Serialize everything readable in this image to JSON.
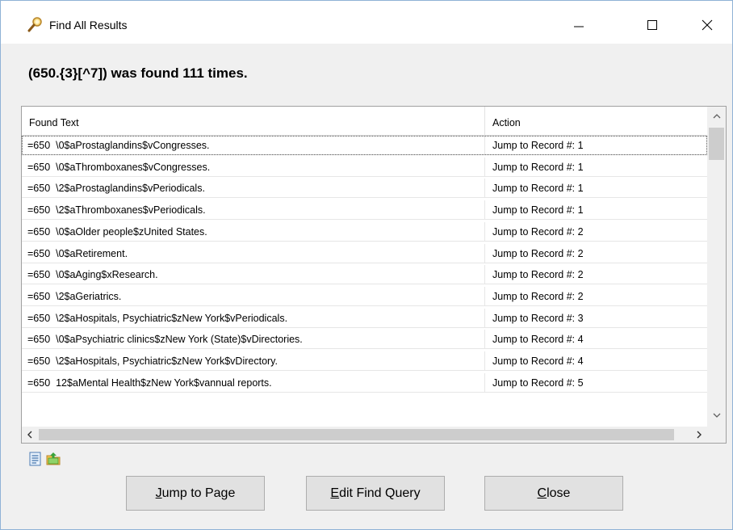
{
  "window": {
    "title": "Find All Results",
    "title_icon": "magnifier-icon"
  },
  "header": {
    "message": "(650.{3}[^7]) was found 111 times."
  },
  "grid": {
    "columns": [
      "Found Text",
      "Action"
    ],
    "rows": [
      {
        "found": "=650  \\0$aProstaglandins$vCongresses.",
        "action": "Jump to Record #: 1"
      },
      {
        "found": "=650  \\0$aThromboxanes$vCongresses.",
        "action": "Jump to Record #: 1"
      },
      {
        "found": "=650  \\2$aProstaglandins$vPeriodicals.",
        "action": "Jump to Record #: 1"
      },
      {
        "found": "=650  \\2$aThromboxanes$vPeriodicals.",
        "action": "Jump to Record #: 1"
      },
      {
        "found": "=650  \\0$aOlder people$zUnited States.",
        "action": "Jump to Record #: 2"
      },
      {
        "found": "=650  \\0$aRetirement.",
        "action": "Jump to Record #: 2"
      },
      {
        "found": "=650  \\0$aAging$xResearch.",
        "action": "Jump to Record #: 2"
      },
      {
        "found": "=650  \\2$aGeriatrics.",
        "action": "Jump to Record #: 2"
      },
      {
        "found": "=650  \\2$aHospitals, Psychiatric$zNew York$vPeriodicals.",
        "action": "Jump to Record #: 3"
      },
      {
        "found": "=650  \\0$aPsychiatric clinics$zNew York (State)$vDirectories.",
        "action": "Jump to Record #: 4"
      },
      {
        "found": "=650  \\2$aHospitals, Psychiatric$zNew York$vDirectory.",
        "action": "Jump to Record #: 4"
      },
      {
        "found": "=650  12$aMental Health$zNew York$vannual reports.",
        "action": "Jump to Record #: 5"
      }
    ]
  },
  "toolbar": {
    "icons": [
      "report-icon",
      "export-icon"
    ]
  },
  "buttons": {
    "jump_pre": "",
    "jump_key": "J",
    "jump_rest": "ump to Page",
    "edit_pre": "",
    "edit_key": "E",
    "edit_rest": "dit Find Query",
    "close_pre": "",
    "close_key": "C",
    "close_rest": "lose"
  },
  "colors": {
    "window_bg": "#f0f0f0",
    "titlebar_bg": "#ffffff",
    "button_bg": "#e1e1e1",
    "scroll_thumb": "#cdcdcd"
  }
}
